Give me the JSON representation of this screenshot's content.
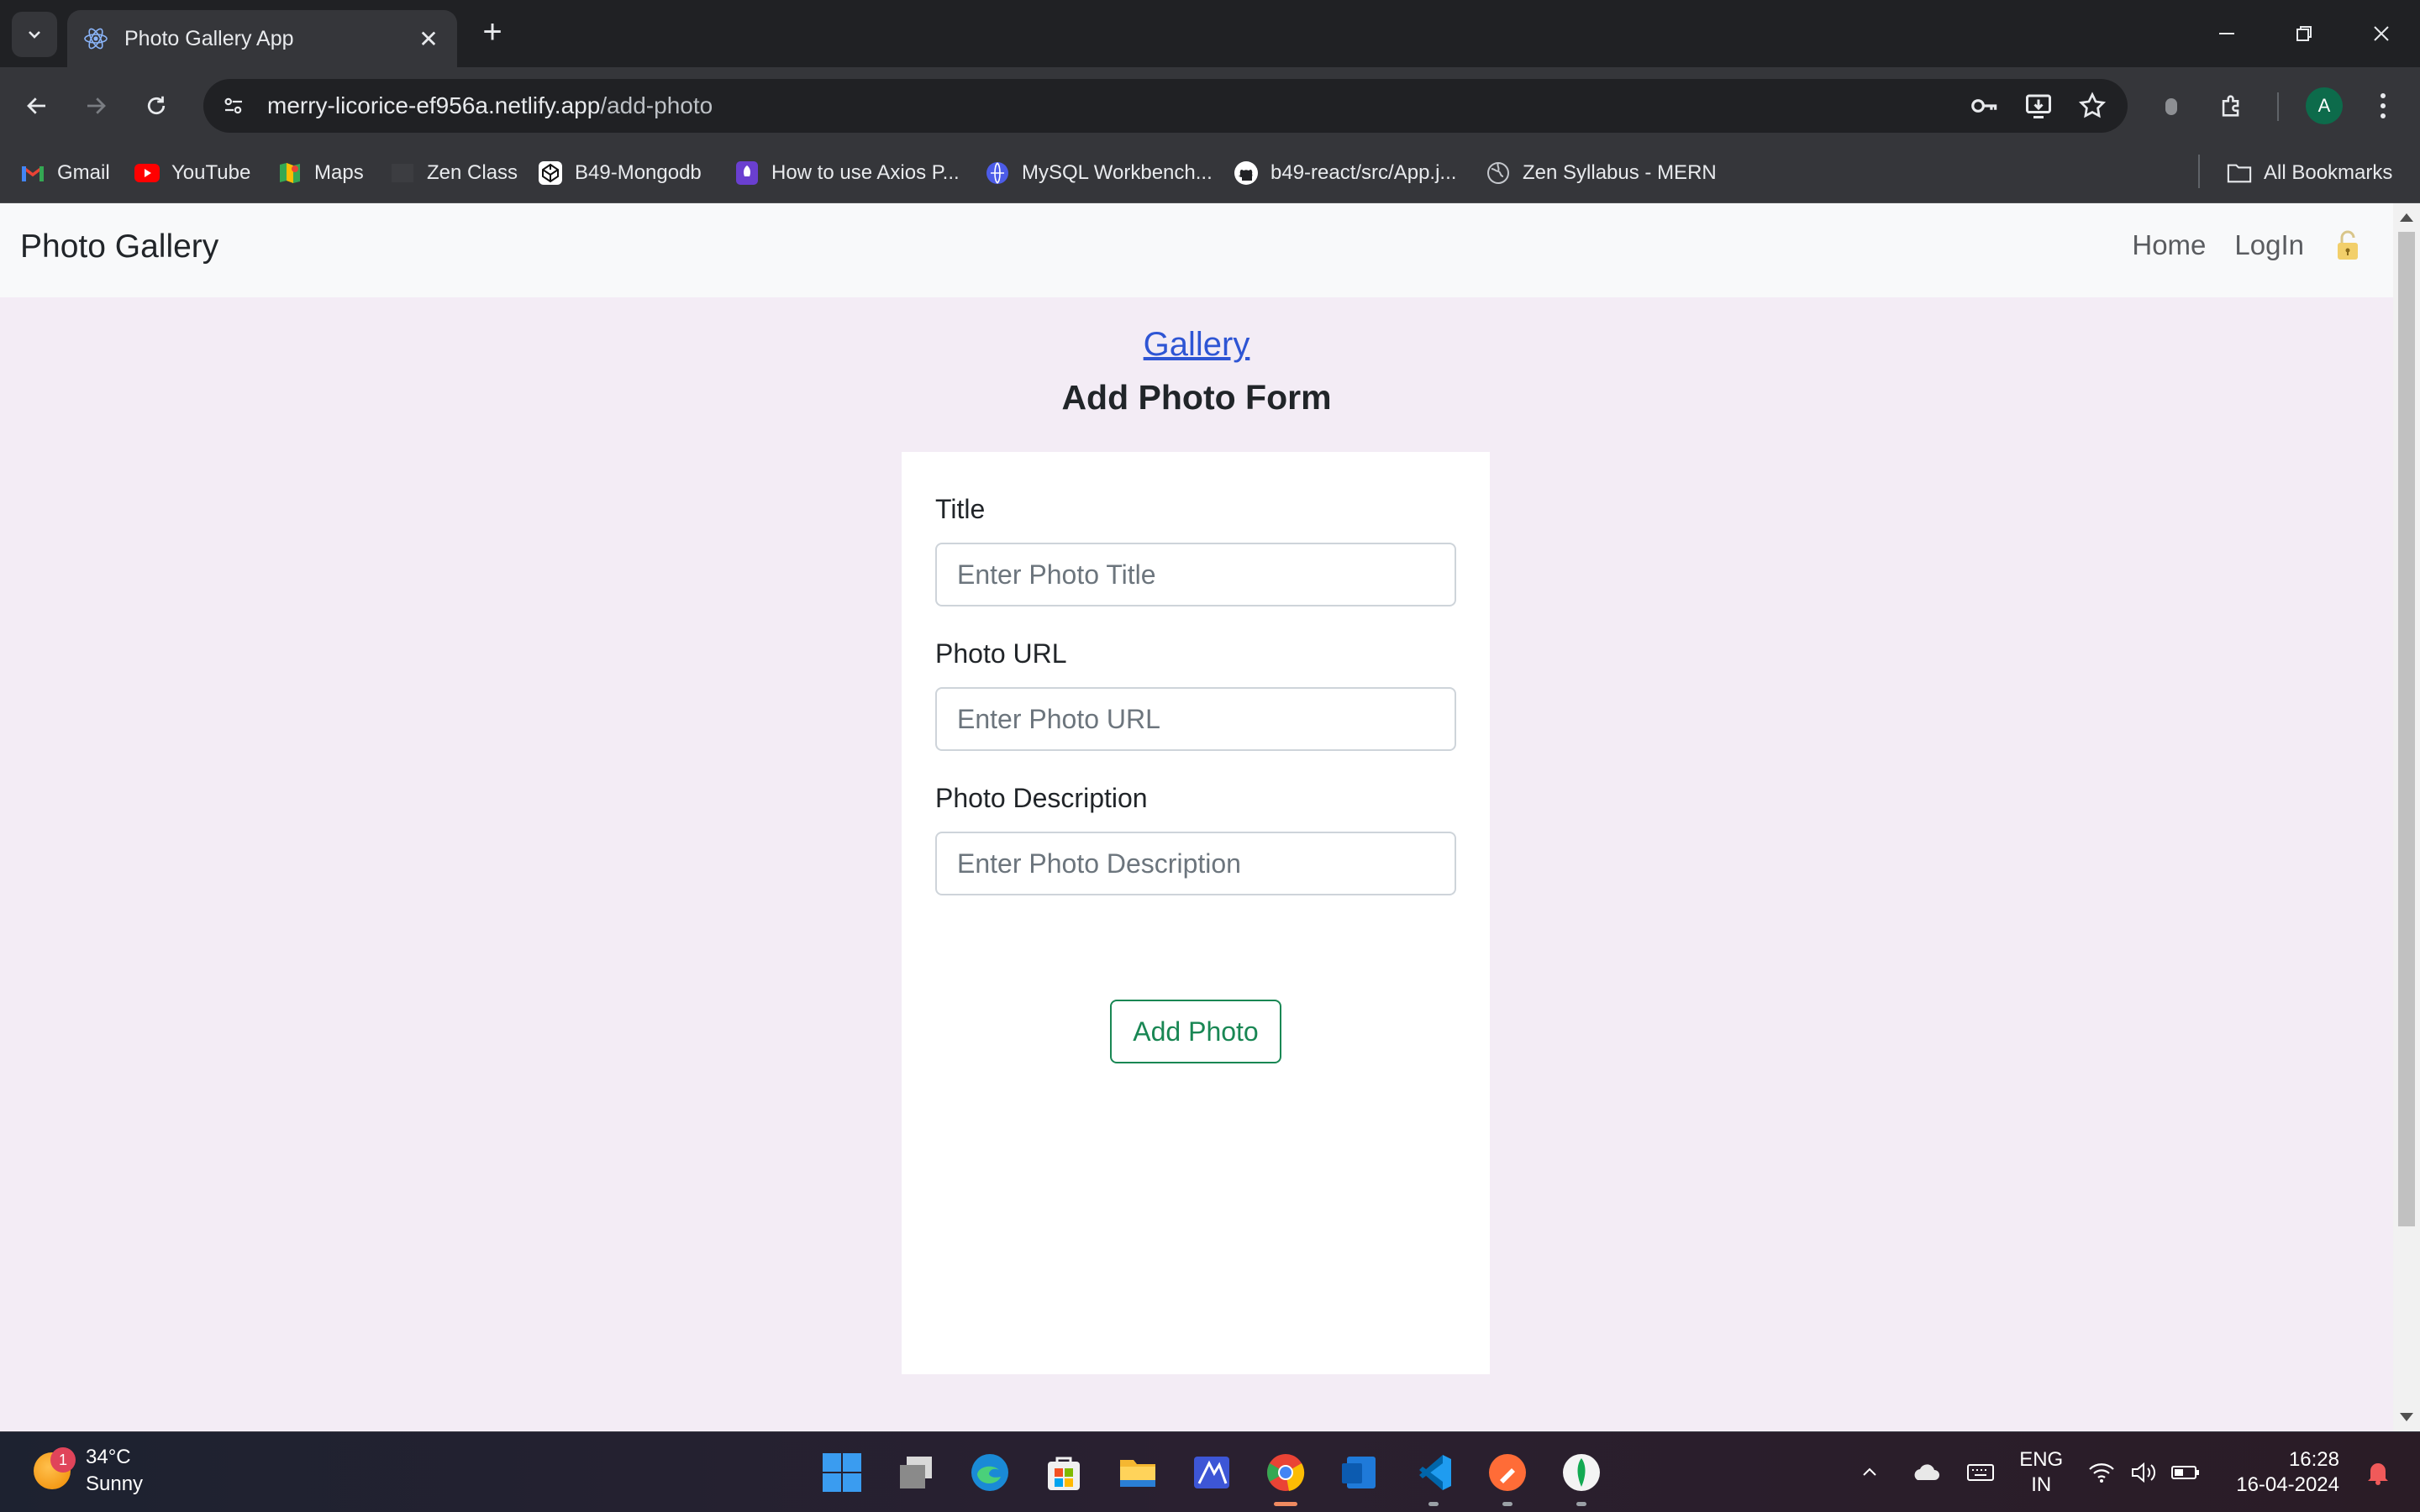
{
  "browser": {
    "tab_title": "Photo Gallery App",
    "url_host": "merry-licorice-ef956a.netlify.app",
    "url_path": "/add-photo",
    "profile_initial": "A",
    "bookmarks": [
      {
        "label": "Gmail",
        "icon": "gmail-icon"
      },
      {
        "label": "YouTube",
        "icon": "youtube-icon"
      },
      {
        "label": "Maps",
        "icon": "maps-icon"
      },
      {
        "label": "Zen Class",
        "icon": "zen-class-icon"
      },
      {
        "label": "B49-Mongodb",
        "icon": "codepen-icon"
      },
      {
        "label": "How to use Axios P...",
        "icon": "rocket-icon"
      },
      {
        "label": "MySQL Workbench...",
        "icon": "globe-blue-icon"
      },
      {
        "label": "b49-react/src/App.j...",
        "icon": "github-icon"
      },
      {
        "label": "Zen Syllabus - MERN",
        "icon": "globe-icon"
      }
    ],
    "all_bookmarks": "All Bookmarks"
  },
  "page": {
    "brand": "Photo Gallery",
    "nav": {
      "home": "Home",
      "login": "LogIn"
    },
    "gallery_link": "Gallery",
    "form_title": "Add Photo Form",
    "form": {
      "title_label": "Title",
      "title_placeholder": "Enter Photo Title",
      "url_label": "Photo URL",
      "url_placeholder": "Enter Photo URL",
      "desc_label": "Photo Description",
      "desc_placeholder": "Enter Photo Description",
      "submit": "Add Photo"
    }
  },
  "taskbar": {
    "weather_temp": "34°C",
    "weather_cond": "Sunny",
    "weather_badge": "1",
    "lang_1": "ENG",
    "lang_2": "IN",
    "time": "16:28",
    "date": "16-04-2024"
  },
  "colors": {
    "page_bg": "#f3ecf5",
    "link": "#2e55d4",
    "success": "#198754"
  }
}
